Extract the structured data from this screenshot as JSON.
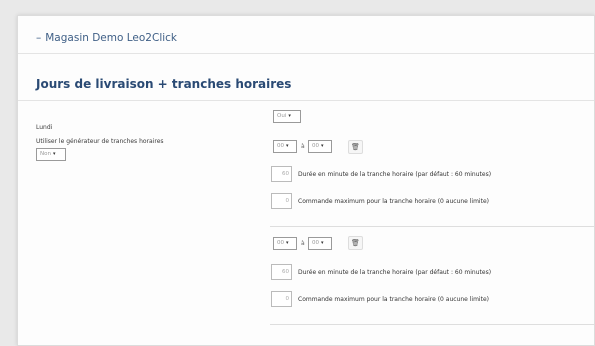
{
  "header": {
    "dash": "–",
    "shop_name": "Magasin Demo Leo2Click"
  },
  "section": {
    "title": "Jours de livraison + tranches horaires"
  },
  "fields": {
    "day_label": "Lundi",
    "day_select": "Oui",
    "generator_label": "Utiliser le générateur de tranches horaires",
    "generator_select": "Non"
  },
  "slots": [
    {
      "start_select": "00",
      "to_label": "à",
      "end_select": "00",
      "duration_value": "60",
      "duration_desc": "Durée en minute de la tranche horaire (par défaut : 60 minutes)",
      "max_value": "0",
      "max_desc": "Commande maximum pour la tranche horaire (0 aucune limite)"
    },
    {
      "start_select": "00",
      "to_label": "à",
      "end_select": "00",
      "duration_value": "60",
      "duration_desc": "Durée en minute de la tranche horaire (par défaut : 60 minutes)",
      "max_value": "0",
      "max_desc": "Commande maximum pour la tranche horaire (0 aucune limite)"
    }
  ],
  "icons": {
    "caret": "▾",
    "trash": "🗑"
  }
}
